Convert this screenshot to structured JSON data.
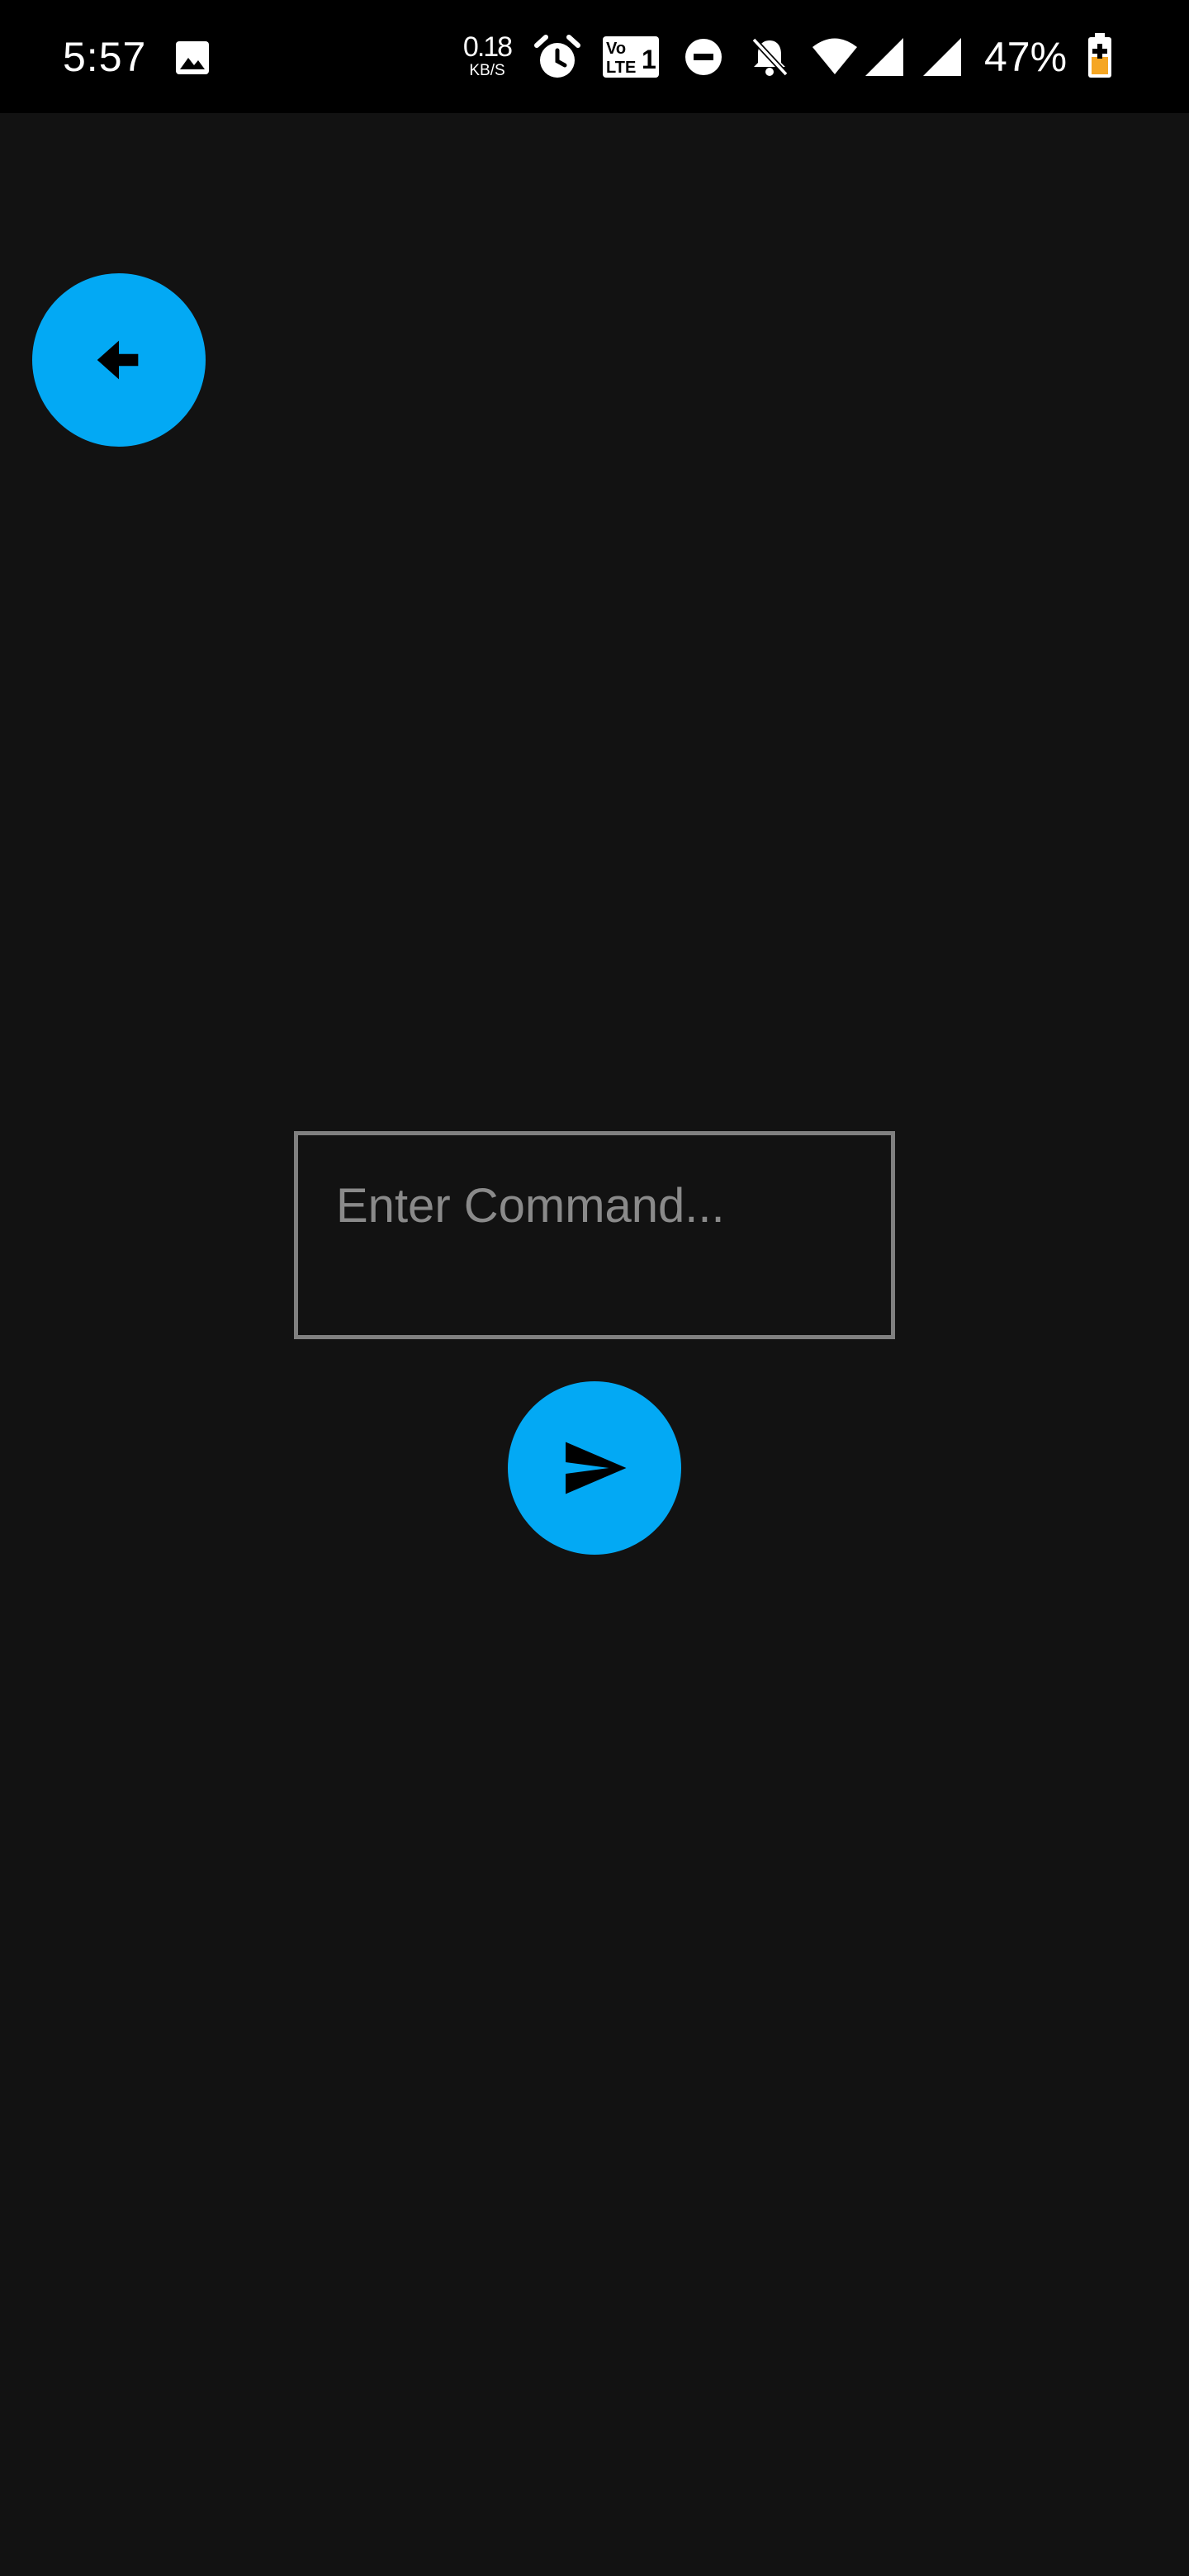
{
  "status_bar": {
    "time": "5:57",
    "net_speed_value": "0.18",
    "net_speed_unit": "KB/S",
    "volte_label": "Vo LTE 1",
    "battery_percent": "47%",
    "icons": [
      "gallery-icon",
      "alarm-icon",
      "volte-icon",
      "do-not-disturb-icon",
      "notifications-off-icon",
      "wifi-icon",
      "signal-icon",
      "signal-icon-2",
      "battery-charging-icon"
    ]
  },
  "back_button": {
    "icon": "back-arrow-icon"
  },
  "command": {
    "placeholder": "Enter Command...",
    "value": ""
  },
  "send_button": {
    "icon": "send-icon"
  },
  "colors": {
    "background": "#121212",
    "status_bar": "#000000",
    "accent": "#03A9F4",
    "input_border": "#808080",
    "placeholder": "#8a8a8a",
    "battery_charge": "#F5A623"
  }
}
